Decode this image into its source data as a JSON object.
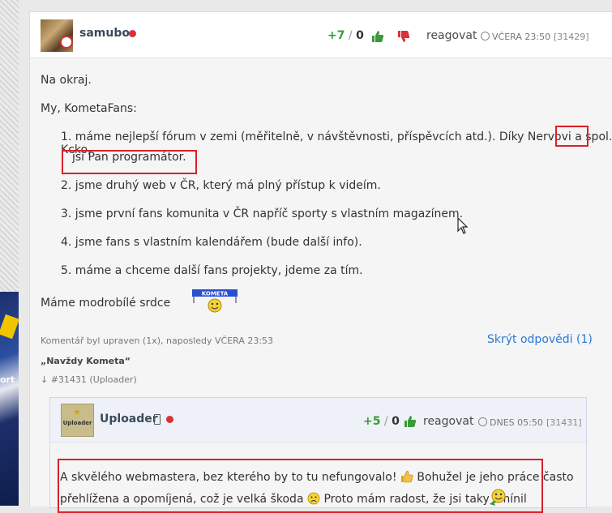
{
  "post": {
    "username": "samubo",
    "rating_plus": "+7",
    "rating_sep": " / ",
    "rating_minus": "0",
    "reply_label": "reagovat",
    "timestamp": "VČERA 23:50",
    "post_id": "[31429]",
    "intro": "Na okraj.",
    "greeting": "My, KometaFans:",
    "list": [
      "1. máme nejlepší fórum v zemi (měřitelně, v návštěvnosti, příspěvcích atd.). Díky Nervovi a spol. Kcko,",
      "jsi Pan programátor.",
      "2. jsme druhý web v ČR, který má plný přístup k videím.",
      "3. jsme první fans komunita v ČR napříč sporty s vlastním magazínem.",
      "4. jsme fans s vlastním kalendářem (bude další info).",
      "5. máme a chceme další fans projekty, jdeme za tím."
    ],
    "closing": "Máme modrobílé srdce",
    "kometa_emote_text": "KOMETA",
    "edit_note": "Komentář byl upraven (1x), naposledy VČERA 23:53",
    "hide_replies": "Skrýt odpovědi (1)",
    "signature": "„Navždy Kometa“",
    "reply_ref": "↓ #31431 (Uploader)"
  },
  "reply": {
    "username": "Uploader",
    "avatar_label": "Uploader",
    "rating_plus": "+5",
    "rating_sep": " / ",
    "rating_minus": "0",
    "reply_label": "reagovat",
    "timestamp": "DNES 05:50",
    "post_id": "[31431]",
    "line1": "A skvělého webmastera, bez kterého by to tu nefungovalo!",
    "line1b": "Bohužel je jeho práce často",
    "line2": "přehlížena a opomíjená, což je velká škoda",
    "line2b": "Proto mám radost, že jsi taky zmínil"
  },
  "colors": {
    "positive": "#3a9a3a",
    "negative": "#d9303a",
    "link": "#2a78d6",
    "highlight": "#d9202a"
  }
}
